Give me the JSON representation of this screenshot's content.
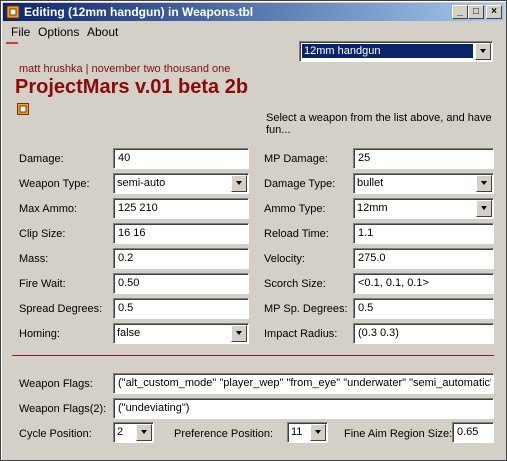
{
  "window": {
    "title": "Editing (12mm handgun) in Weapons.tbl"
  },
  "title_buttons": {
    "minimize": "_",
    "maximize": "□",
    "close": "×"
  },
  "menu": [
    "File",
    "Options",
    "About"
  ],
  "weapon_selector": {
    "value": "12mm handgun"
  },
  "header": {
    "author": "matt hrushka | november two thousand one",
    "title": "ProjectMars v.01 beta 2b",
    "hint": "Select a weapon from the list above, and have fun..."
  },
  "left_fields": [
    {
      "label": "Damage:",
      "value": "40",
      "kind": "text"
    },
    {
      "label": "Weapon Type:",
      "value": "semi-auto",
      "kind": "combo"
    },
    {
      "label": "Max Ammo:",
      "value": "125 210",
      "kind": "text"
    },
    {
      "label": "Clip Size:",
      "value": "16 16",
      "kind": "text"
    },
    {
      "label": "Mass:",
      "value": "0.2",
      "kind": "text"
    },
    {
      "label": "Fire Wait:",
      "value": "0.50",
      "kind": "text"
    },
    {
      "label": "Spread Degrees:",
      "value": "0.5",
      "kind": "text"
    },
    {
      "label": "Homing:",
      "value": "false",
      "kind": "combo"
    }
  ],
  "right_fields": [
    {
      "label": "MP Damage:",
      "value": "25",
      "kind": "text"
    },
    {
      "label": "Damage Type:",
      "value": "bullet",
      "kind": "combo"
    },
    {
      "label": "Ammo Type:",
      "value": "12mm",
      "kind": "combo"
    },
    {
      "label": "Reload Time:",
      "value": "1.1",
      "kind": "text"
    },
    {
      "label": "Velocity:",
      "value": "275.0",
      "kind": "text"
    },
    {
      "label": "Scorch Size:",
      "value": "<0.1, 0.1, 0.1>",
      "kind": "text"
    },
    {
      "label": "MP Sp. Degrees:",
      "value": "0.5",
      "kind": "text"
    },
    {
      "label": "Impact Radius:",
      "value": "(0.3 0.3)",
      "kind": "text"
    }
  ],
  "flags": {
    "label": "Weapon Flags:",
    "value": "(\"alt_custom_mode\" \"player_wep\" \"from_eye\" \"underwater\" \"semi_automatic\"",
    "label2": "Weapon Flags(2):",
    "value2": "(\"undeviating\")"
  },
  "bottom": {
    "cycle_label": "Cycle Position:",
    "cycle_value": "2",
    "pref_label": "Preference Position:",
    "pref_value": "11",
    "aim_label": "Fine Aim Region Size:",
    "aim_value": "0.65"
  }
}
